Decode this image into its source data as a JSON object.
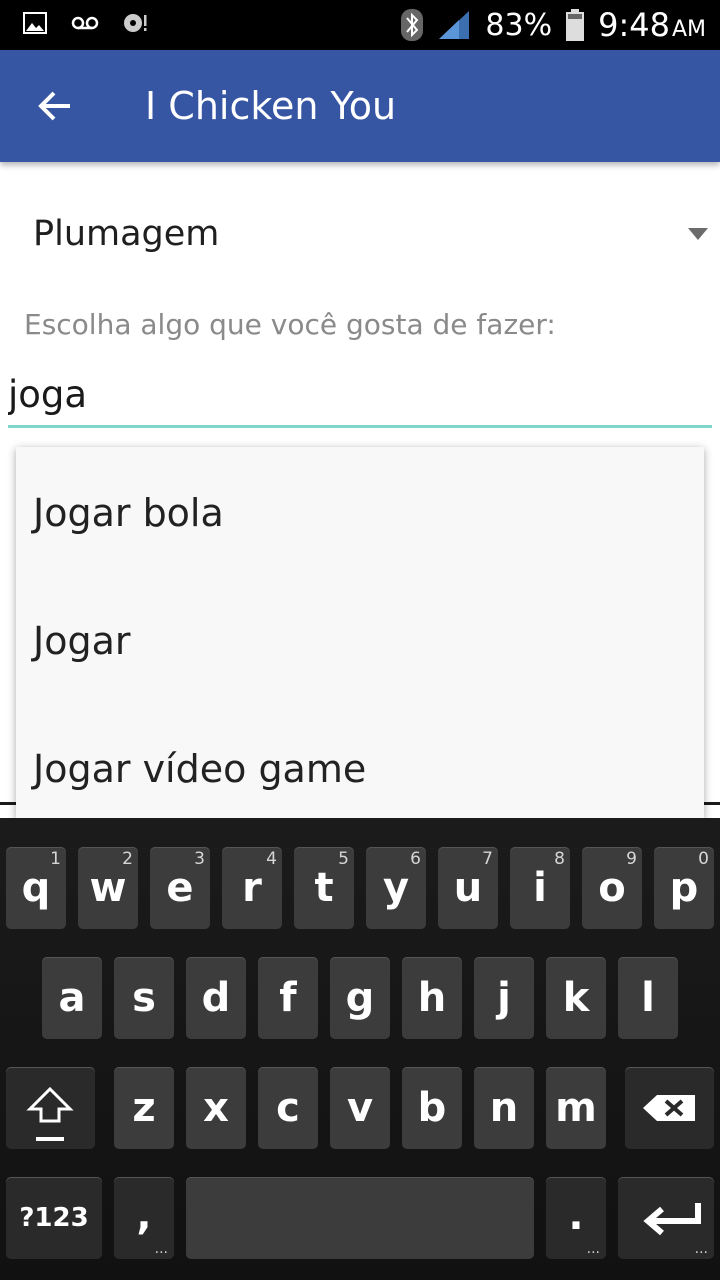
{
  "status_bar": {
    "icons": [
      "image-icon",
      "voicemail-icon",
      "sync-alert-icon",
      "bluetooth-icon",
      "signal-icon",
      "battery-icon"
    ],
    "battery": "83%",
    "time": "9:48",
    "ampm": "AM"
  },
  "app_bar": {
    "title": "I Chicken You",
    "back_icon": "arrow-left-icon",
    "color": "#3655a3"
  },
  "form": {
    "spinner_value": "Plumagem",
    "field_label": "Escolha algo que você gosta de fazer:",
    "input_value": "joga",
    "accent": "#7fd6cc"
  },
  "suggestions": [
    "Jogar bola",
    "Jogar",
    "Jogar vídeo game"
  ],
  "keyboard": {
    "row1": [
      {
        "k": "q",
        "h": "1"
      },
      {
        "k": "w",
        "h": "2"
      },
      {
        "k": "e",
        "h": "3"
      },
      {
        "k": "r",
        "h": "4"
      },
      {
        "k": "t",
        "h": "5"
      },
      {
        "k": "y",
        "h": "6"
      },
      {
        "k": "u",
        "h": "7"
      },
      {
        "k": "i",
        "h": "8"
      },
      {
        "k": "o",
        "h": "9"
      },
      {
        "k": "p",
        "h": "0"
      }
    ],
    "row2": [
      "a",
      "s",
      "d",
      "f",
      "g",
      "h",
      "j",
      "k",
      "l"
    ],
    "row3": [
      "z",
      "x",
      "c",
      "v",
      "b",
      "n",
      "m"
    ],
    "symbols_label": "?123",
    "comma_label": ",",
    "period_label": "."
  }
}
